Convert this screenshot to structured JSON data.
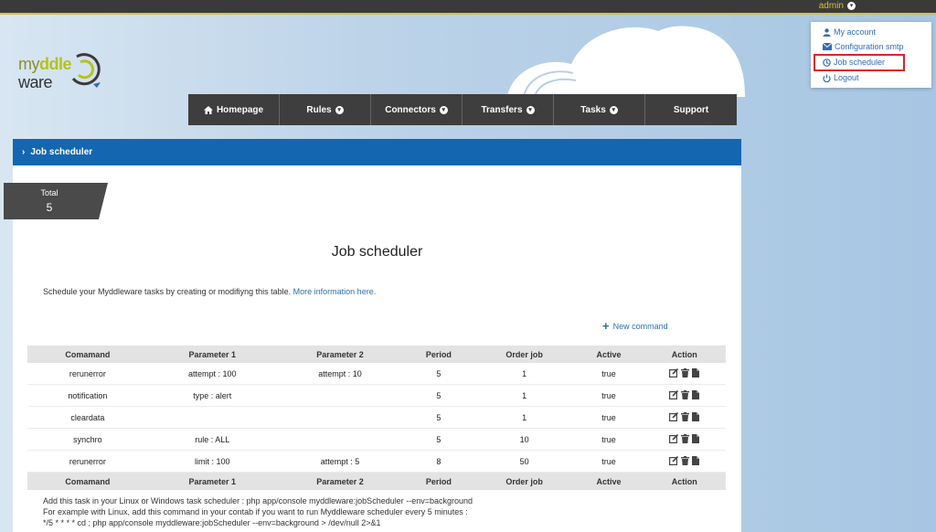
{
  "topbar": {
    "user": "admin"
  },
  "logo": {
    "line1_a": "my",
    "line1_b": "ddle",
    "line2": "ware"
  },
  "nav": [
    {
      "label": "Homepage",
      "icon": "home-icon",
      "dropdown": false
    },
    {
      "label": "Rules",
      "dropdown": true
    },
    {
      "label": "Connectors",
      "dropdown": true
    },
    {
      "label": "Transfers",
      "dropdown": true
    },
    {
      "label": "Tasks",
      "dropdown": true
    },
    {
      "label": "Support",
      "dropdown": false
    }
  ],
  "breadcrumb": {
    "label": "Job scheduler"
  },
  "total": {
    "label": "Total",
    "value": "5"
  },
  "page": {
    "title": "Job scheduler",
    "description": "Schedule your Myddleware tasks by creating or modifiyng this table.",
    "more_link": "More information here.",
    "new_command": "New command"
  },
  "table": {
    "columns": [
      "Comamand",
      "Parameter 1",
      "Parameter 2",
      "Period",
      "Order job",
      "Active",
      "Action"
    ],
    "rows": [
      [
        "rerunerror",
        "attempt : 100",
        "attempt : 10",
        "5",
        "1",
        "true"
      ],
      [
        "notification",
        "type : alert",
        "",
        "5",
        "1",
        "true"
      ],
      [
        "cleardata",
        "",
        "",
        "5",
        "1",
        "true"
      ],
      [
        "synchro",
        "rule : ALL",
        "",
        "5",
        "10",
        "true"
      ],
      [
        "rerunerror",
        "limit : 100",
        "attempt : 5",
        "8",
        "50",
        "true"
      ]
    ]
  },
  "footer": {
    "line1": "Add this task in your Linux or Windows task scheduler : php app/console myddleware:jobScheduler --env=background",
    "line2": "For example with Linux, add this command in your contab if you want to run Myddleware scheduler every 5 minutes :",
    "line3": "*/5 * * * * cd ; php app/console myddleware:jobScheduler --env=background > /dev/null 2>&1"
  },
  "user_menu": {
    "items": [
      {
        "label": "My account",
        "icon": "user-icon"
      },
      {
        "label": "Configuration smtp",
        "icon": "envelope-icon"
      },
      {
        "label": "Job scheduler",
        "icon": "clock-icon",
        "highlighted": true
      },
      {
        "label": "Logout",
        "icon": "power-icon"
      }
    ]
  },
  "colors": {
    "accent": "#1566b0",
    "topbar": "#3a3a3a",
    "highlight": "#e3202a",
    "admin": "#d8c22a"
  }
}
